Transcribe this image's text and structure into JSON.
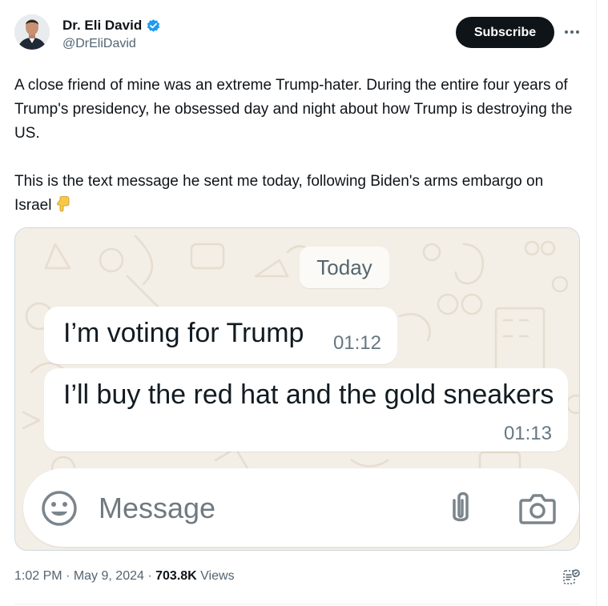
{
  "author": {
    "display_name": "Dr. Eli David",
    "handle": "@DrEliDavid",
    "verified_color": "#1d9bf0"
  },
  "actions": {
    "subscribe_label": "Subscribe",
    "more_icon": "more-horizontal-icon"
  },
  "tweet": {
    "paragraph_1": "A close friend of mine was an extreme Trump-hater. During the entire four years of Trump's presidency, he obsessed day and night about how Trump is destroying the US.",
    "paragraph_2": "This is the text message he sent me today, following Biden's arms embargo on Israel",
    "emoji": "backhand-index-pointing-down"
  },
  "media": {
    "date_chip": "Today",
    "messages": [
      {
        "text": "I’m voting for Trump",
        "time": "01:12"
      },
      {
        "text": "I’ll buy the red hat and the gold sneakers",
        "time": "01:13"
      }
    ],
    "compose_placeholder": "Message",
    "compose_icons": [
      "emoji-icon",
      "paperclip-icon",
      "camera-icon"
    ]
  },
  "meta": {
    "time": "1:02 PM",
    "separator": "·",
    "date": "May 9, 2024",
    "views_count": "703.8K",
    "views_label": "Views"
  }
}
